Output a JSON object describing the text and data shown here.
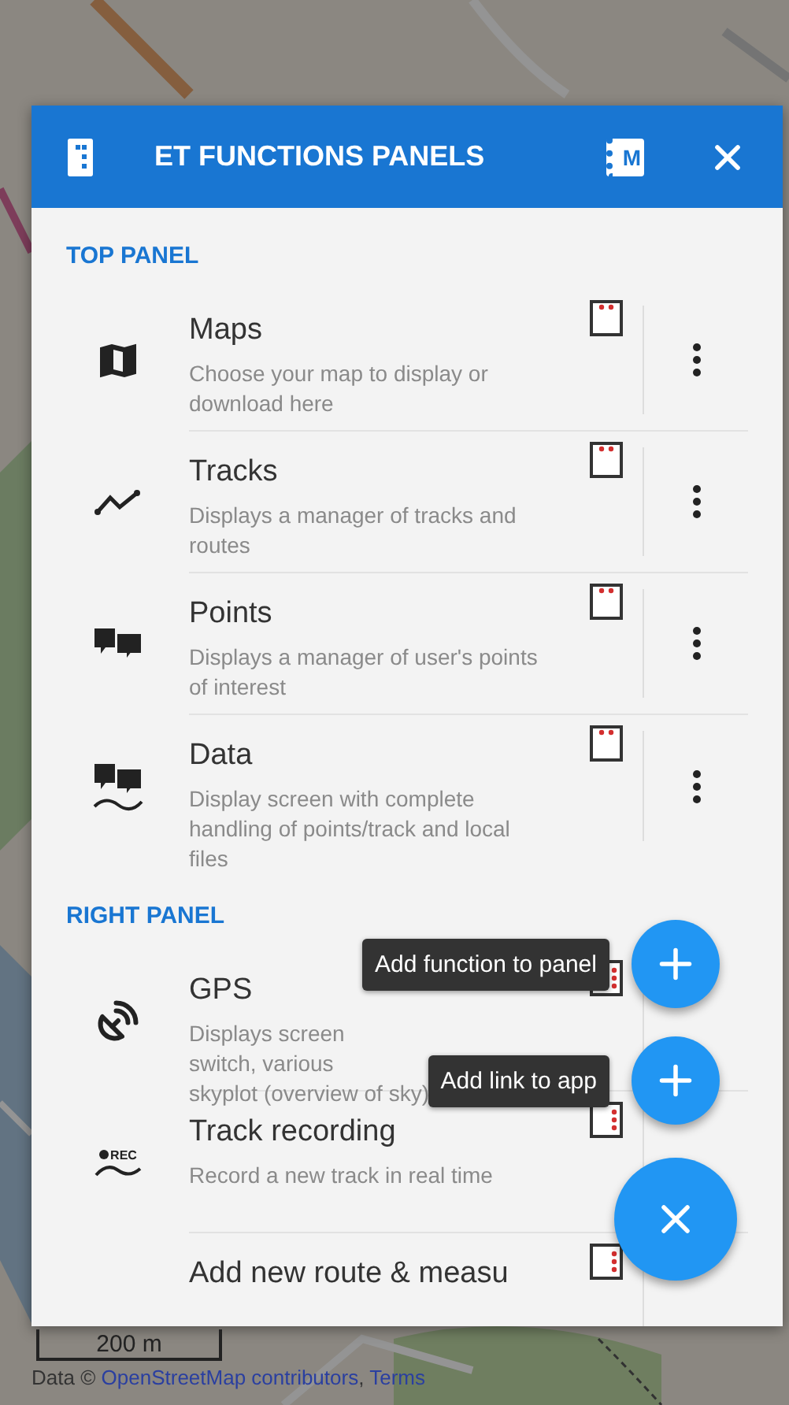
{
  "header": {
    "title": "ET FUNCTIONS PANELS",
    "manual_letter": "M"
  },
  "sections": [
    {
      "title": "TOP PANEL",
      "kind": "top",
      "items": [
        {
          "kind": "map",
          "name": "Maps",
          "description": "Choose your map to display or download here",
          "more_menu": true
        },
        {
          "kind": "tracks",
          "name": "Tracks",
          "description": "Displays a manager of tracks and routes",
          "more_menu": true
        },
        {
          "kind": "points",
          "name": "Points",
          "description": "Displays a manager of user's points of interest",
          "more_menu": true
        },
        {
          "kind": "data",
          "name": "Data",
          "description": "Display screen with complete handling of points/track and local files",
          "more_menu": true
        }
      ]
    },
    {
      "title": "RIGHT PANEL",
      "kind": "right",
      "items": [
        {
          "kind": "gps",
          "name": "GPS",
          "description": [
            "Displays screen",
            "switch, various",
            "skyplot (overview of sky)"
          ],
          "more_menu": false
        },
        {
          "kind": "rec",
          "icon_label": "REC",
          "name": "Track recording",
          "description": "Record a new track in real time",
          "more_menu": false
        },
        {
          "kind": "route",
          "name": "Add new route & measu",
          "more_menu": false
        }
      ]
    }
  ],
  "fab_menu": [
    {
      "kind": "add",
      "tooltip": "Add function to panel"
    },
    {
      "kind": "add",
      "tooltip": "Add link to app"
    },
    {
      "kind": "close"
    }
  ],
  "map": {
    "scale": "200 m",
    "attribution_prefix": "Data ©",
    "attribution_link": "OpenStreetMap contributors",
    "attribution_sep": ",",
    "terms_link": "Terms"
  }
}
